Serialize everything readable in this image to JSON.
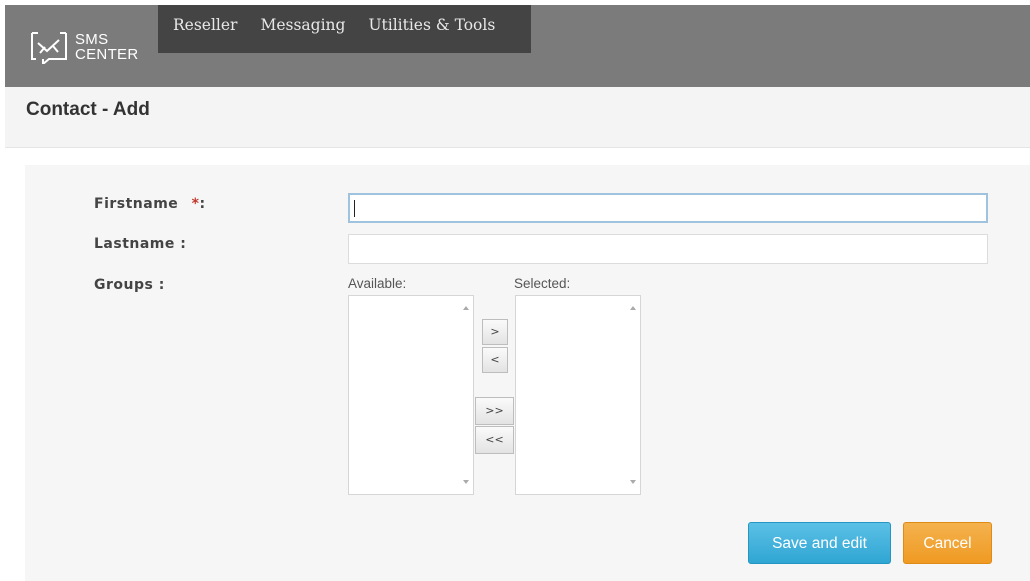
{
  "brand": {
    "line1": "SMS",
    "line2": "CENTER"
  },
  "nav": {
    "items": [
      {
        "label": "Reseller"
      },
      {
        "label": "Messaging"
      },
      {
        "label": "Utilities & Tools"
      }
    ]
  },
  "page": {
    "title": "Contact - Add"
  },
  "form": {
    "firstname_label": "Firstname",
    "required_mark": "*",
    "firstname_colon": ":",
    "firstname_value": "",
    "lastname_label": "Lastname :",
    "lastname_value": "",
    "groups_label": "Groups :",
    "available_label": "Available:",
    "selected_label": "Selected:",
    "move_right": ">",
    "move_left": "<",
    "move_all_right": ">>",
    "move_all_left": "<<"
  },
  "actions": {
    "save_label": "Save and edit",
    "cancel_label": "Cancel"
  },
  "colors": {
    "topbar": "#7b7b7b",
    "nav": "#444444",
    "save": "#2fa6d3",
    "cancel": "#ef9a22",
    "required": "#c0392b"
  }
}
